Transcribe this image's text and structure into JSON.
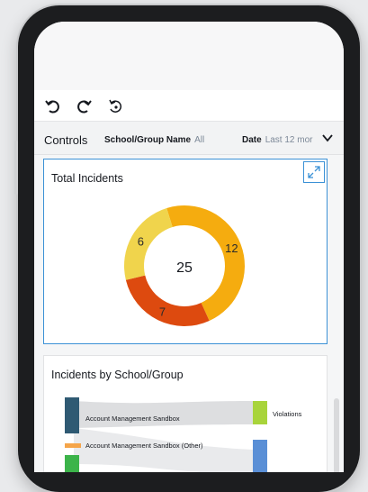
{
  "toolbar": {
    "undo_icon": "undo-icon",
    "redo_icon": "redo-icon",
    "reset_icon": "reset-icon"
  },
  "controls": {
    "label": "Controls",
    "filters": [
      {
        "name": "School/Group Name",
        "value": "All"
      },
      {
        "name": "Date",
        "value": "Last 12 mor"
      }
    ]
  },
  "total_incidents": {
    "title": "Total Incidents",
    "center_value": "25"
  },
  "incidents_by_school": {
    "title": "Incidents by School/Group"
  },
  "chart_data": [
    {
      "type": "pie",
      "title": "Total Incidents",
      "center_label": "25",
      "slices": [
        {
          "value": 12,
          "color": "#f5ac0f"
        },
        {
          "value": 7,
          "color": "#dd4a0f"
        },
        {
          "value": 6,
          "color": "#f0d44c"
        }
      ]
    },
    {
      "type": "sankey",
      "title": "Incidents by School/Group",
      "sources": [
        {
          "label": "Account Management Sandbox",
          "color": "#2f5a73"
        },
        {
          "label": "Account Management Sandbox (Other)",
          "color": "#f5a54a"
        }
      ],
      "targets": [
        {
          "label": "Violations",
          "color": "#a8d43b"
        },
        {
          "label": "",
          "color": "#5a8fd6"
        }
      ]
    }
  ]
}
